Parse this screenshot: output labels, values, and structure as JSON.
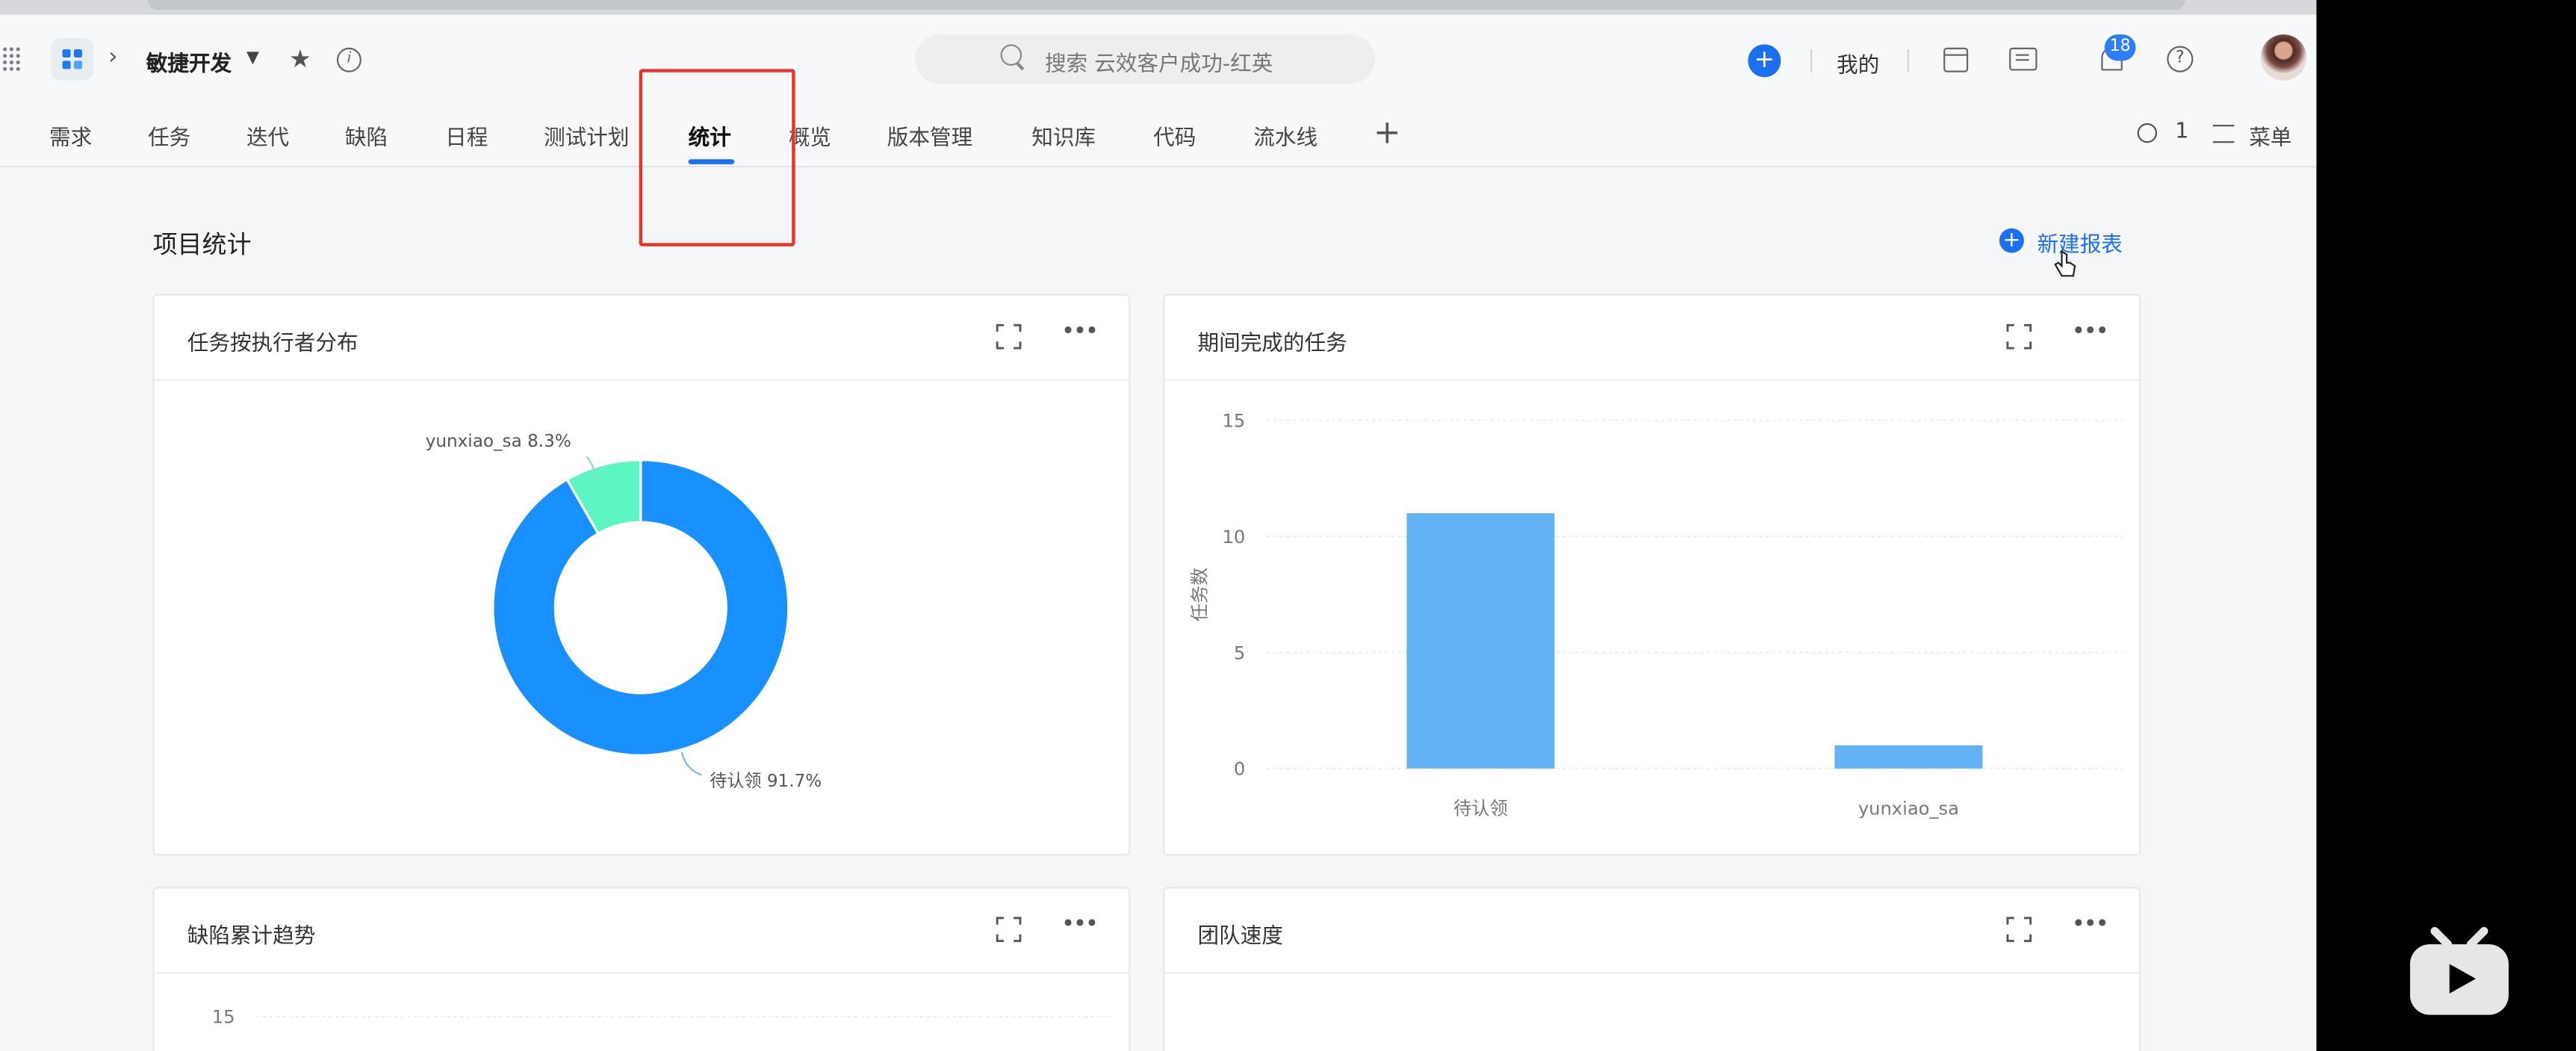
{
  "topbar": {
    "project_name": "敏捷开发",
    "search_placeholder": "搜索 云效客户成功-红英",
    "mine_label": "我的",
    "notification_count": "18"
  },
  "nav": {
    "tabs": [
      "需求",
      "任务",
      "迭代",
      "缺陷",
      "日程",
      "测试计划",
      "统计",
      "概览",
      "版本管理",
      "知识库",
      "代码",
      "流水线"
    ],
    "active_tab": "统计",
    "member_count": "1",
    "menu_label": "菜单"
  },
  "page": {
    "title": "项目统计",
    "new_report_label": "新建报表"
  },
  "cards": [
    {
      "title": "任务按执行者分布"
    },
    {
      "title": "期间完成的任务"
    },
    {
      "title": "缺陷累计趋势"
    },
    {
      "title": "团队速度"
    }
  ],
  "chart_data": [
    {
      "type": "pie",
      "categories": [
        "待认领",
        "yunxiao_sa"
      ],
      "values": [
        91.7,
        8.3
      ],
      "labels": [
        "待认领 91.7%",
        "yunxiao_sa 8.3%"
      ],
      "colors": [
        "#1890ff",
        "#5ef5c4"
      ]
    },
    {
      "type": "bar",
      "categories": [
        "待认领",
        "yunxiao_sa"
      ],
      "values": [
        11,
        1
      ],
      "ylabel": "任务数",
      "yticks": [
        "0",
        "5",
        "10",
        "15"
      ],
      "ylim": [
        0,
        15
      ],
      "color": "#62b2f5"
    },
    {
      "type": "line",
      "yticks": [
        "15"
      ]
    }
  ]
}
